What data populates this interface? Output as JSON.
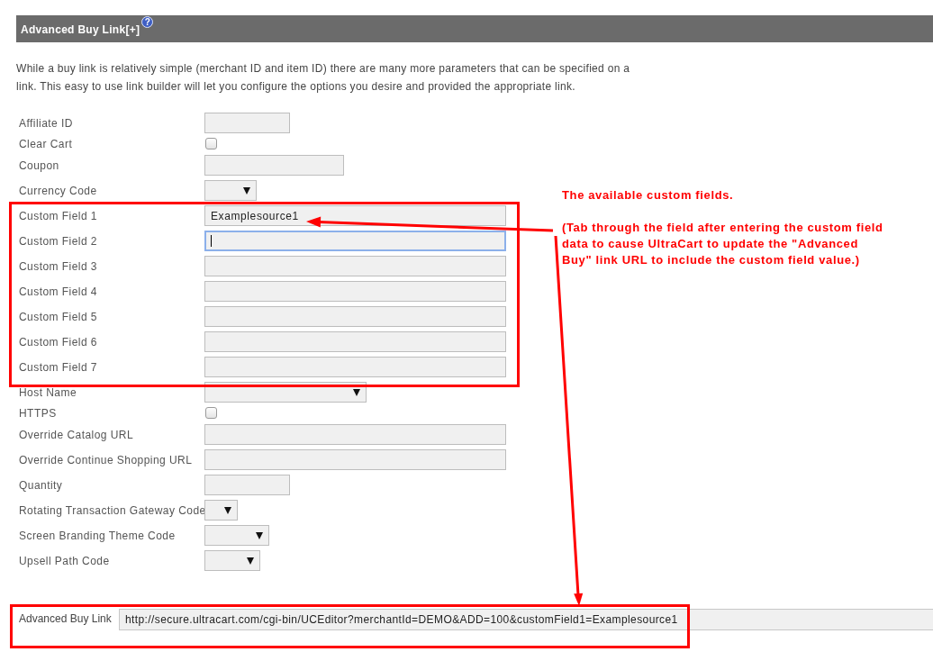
{
  "panel": {
    "title": "Advanced Buy Link[+]",
    "help": "?",
    "description": "While a buy link is relatively simple (merchant ID and item ID) there are many more parameters that can be specified on a link. This easy to use link builder will let you configure the options you desire and provided the appropriate link."
  },
  "fields": [
    {
      "label": "Affiliate ID",
      "kind": "text",
      "focused": false
    },
    {
      "label": "Clear Cart",
      "kind": "checkbox",
      "checked": false
    },
    {
      "label": "Coupon",
      "kind": "text",
      "focused": false
    },
    {
      "label": "Currency Code",
      "kind": "select"
    },
    {
      "label": "Custom Field 1",
      "kind": "text",
      "focused": false,
      "value": "Examplesource1"
    },
    {
      "label": "Custom Field 2",
      "kind": "text",
      "focused": true
    },
    {
      "label": "Custom Field 3",
      "kind": "text",
      "focused": false
    },
    {
      "label": "Custom Field 4",
      "kind": "text",
      "focused": false
    },
    {
      "label": "Custom Field 5",
      "kind": "text",
      "focused": false
    },
    {
      "label": "Custom Field 6",
      "kind": "text",
      "focused": false
    },
    {
      "label": "Custom Field 7",
      "kind": "text",
      "focused": false
    },
    {
      "label": "Host Name",
      "kind": "select"
    },
    {
      "label": "HTTPS",
      "kind": "checkbox",
      "checked": false
    },
    {
      "label": "Override Catalog URL",
      "kind": "text",
      "focused": false
    },
    {
      "label": "Override Continue Shopping URL",
      "kind": "text",
      "focused": false
    },
    {
      "label": "Quantity",
      "kind": "text",
      "focused": false
    },
    {
      "label": "Rotating Transaction Gateway Code",
      "kind": "select"
    },
    {
      "label": "Screen Branding Theme Code",
      "kind": "select"
    },
    {
      "label": "Upsell Path Code",
      "kind": "select"
    }
  ],
  "result": {
    "label": "Advanced Buy Link",
    "value": "http://secure.ultracart.com/cgi-bin/UCEditor?merchantId=DEMO&ADD=100&customField1=Examplesource1"
  },
  "annotation": {
    "heading": "The available custom fields.",
    "note": "(Tab through the field after entering the custom field data to cause UltraCart to update the \"Advanced Buy\" link URL to include the custom field value.)"
  }
}
